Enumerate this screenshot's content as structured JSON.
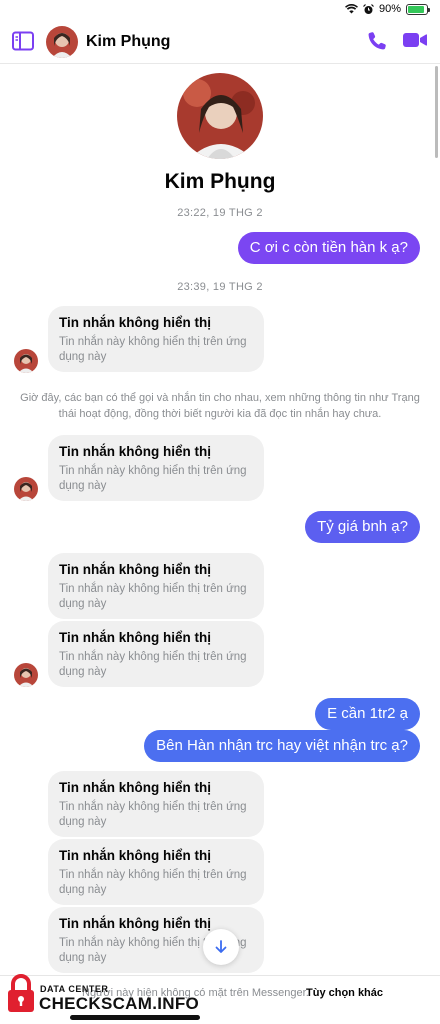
{
  "status_bar": {
    "battery": "90%",
    "battery_level": 0.9,
    "icons": [
      "wifi-icon",
      "alarm-icon",
      "battery-icon"
    ]
  },
  "header": {
    "contact_name": "Kim Phụng",
    "accent_color": "#7b3ff2"
  },
  "profile": {
    "name": "Kim Phụng"
  },
  "conversation": {
    "time1": "23:22, 19 THG 2",
    "msg_out_1": "C ơi c còn tiền hàn k ạ?",
    "time2": "23:39, 19 THG 2",
    "hidden_title": "Tin nhắn không hiển thị",
    "hidden_body": "Tin nhắn này không hiển thị trên ứng dụng này",
    "notice": "Giờ đây, các bạn có thể gọi và nhắn tin cho nhau, xem những thông tin như Trạng thái hoạt động, đồng thời biết người kia đã đọc tin nhắn hay chưa.",
    "msg_out_2": "Tỷ giá bnh ạ?",
    "msg_out_3": "E cần 1tr2 ạ",
    "msg_out_4": "Bên Hàn nhận trc hay việt nhận trc ạ?"
  },
  "footer": {
    "text": "Người này hiện không có mặt trên Messenger.",
    "link": "Tùy chọn khác"
  },
  "watermark": {
    "line1": "DATA CENTER",
    "line2": "CHECKSCAM.INFO"
  }
}
